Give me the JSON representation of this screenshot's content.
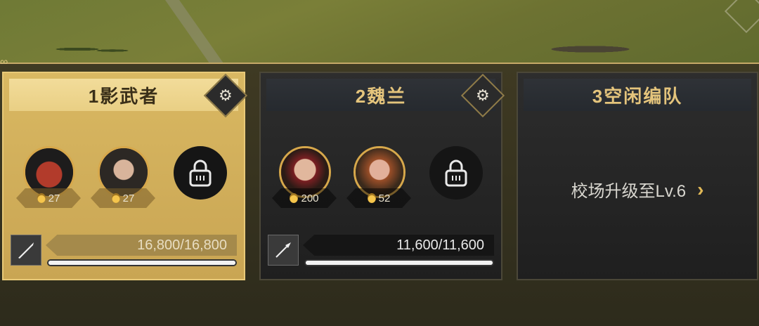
{
  "teams": [
    {
      "title": "1影武者",
      "heroes": [
        {
          "level": "27"
        },
        {
          "level": "27"
        }
      ],
      "troops": "16,800/16,800",
      "troops_fill": 1.0
    },
    {
      "title": "2魏兰",
      "heroes": [
        {
          "level": "200"
        },
        {
          "level": "52"
        }
      ],
      "troops": "11,600/11,600",
      "troops_fill": 1.0
    },
    {
      "title": "3空闲编队",
      "locked_message": "校场升级至Lv.6",
      "chevron": "›"
    }
  ],
  "icons": {
    "gear": "gear-icon",
    "lock": "lock-icon",
    "sword": "sword-icon",
    "spear": "spear-icon",
    "medal": "medal-icon"
  }
}
